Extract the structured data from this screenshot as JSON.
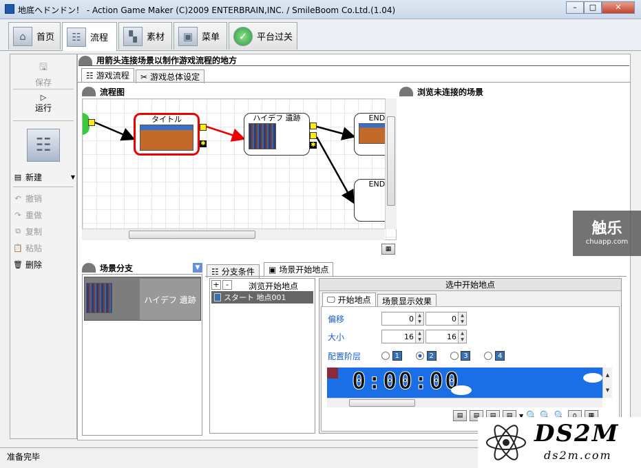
{
  "window": {
    "title": "地底へドンドン！ - Action Game Maker (C)2009 ENTERBRAIN,INC. / SmileBoom Co.Ltd.(1.04)",
    "minimize": "–",
    "maximize": "□",
    "close": "✕"
  },
  "main_tabs": [
    {
      "label": "首页",
      "icon": "home-icon"
    },
    {
      "label": "流程",
      "icon": "flow-icon"
    },
    {
      "label": "素材",
      "icon": "material-icon"
    },
    {
      "label": "菜单",
      "icon": "menu-icon"
    },
    {
      "label": "平台过关",
      "icon": "check-icon"
    }
  ],
  "sidebar": {
    "save": "保存",
    "run": "运行",
    "new": "新建",
    "undo": "撤销",
    "redo": "重做",
    "copy": "复制",
    "paste": "粘贴",
    "delete": "删除"
  },
  "header": {
    "description": "用箭头连接场景以制作游戏流程的地方"
  },
  "sub_tabs": {
    "game_flow": "游戏流程",
    "game_settings": "游戏总体设定"
  },
  "flowchart": {
    "title": "流程图",
    "unconnected_title": "浏览未连接的场景",
    "nodes": [
      {
        "title": "タイトル",
        "selected": true
      },
      {
        "title": "ハイデフ 遺跡",
        "selected": false
      },
      {
        "title": "ENDI",
        "selected": false
      },
      {
        "title": "ENDI",
        "selected": false
      }
    ]
  },
  "branch": {
    "title": "场景分支",
    "item_label": "ハイデフ 遺跡"
  },
  "lower_tabs": {
    "condition": "分支条件",
    "start_point": "场景开始地点"
  },
  "start_list": {
    "plus": "+",
    "minus": "-",
    "header": "浏览开始地点",
    "items": [
      "スタート 地点001"
    ]
  },
  "selected_start": {
    "header": "选中开始地点",
    "tab_start": "开始地点",
    "tab_effect": "场景显示效果",
    "offset_label": "偏移",
    "offset_x": "0",
    "offset_y": "0",
    "size_label": "大小",
    "size_w": "16",
    "size_h": "16",
    "layer_label": "配置阶层",
    "layers": [
      "1",
      "2",
      "3",
      "4"
    ],
    "selected_layer": "2",
    "timer_text": "0:00:00"
  },
  "status": {
    "text": "准备完毕"
  },
  "watermark": {
    "chuapp": "触乐",
    "chuapp_url": "chuapp.com",
    "ds2m": "DS2M",
    "ds2m_url": "ds2m.com"
  }
}
